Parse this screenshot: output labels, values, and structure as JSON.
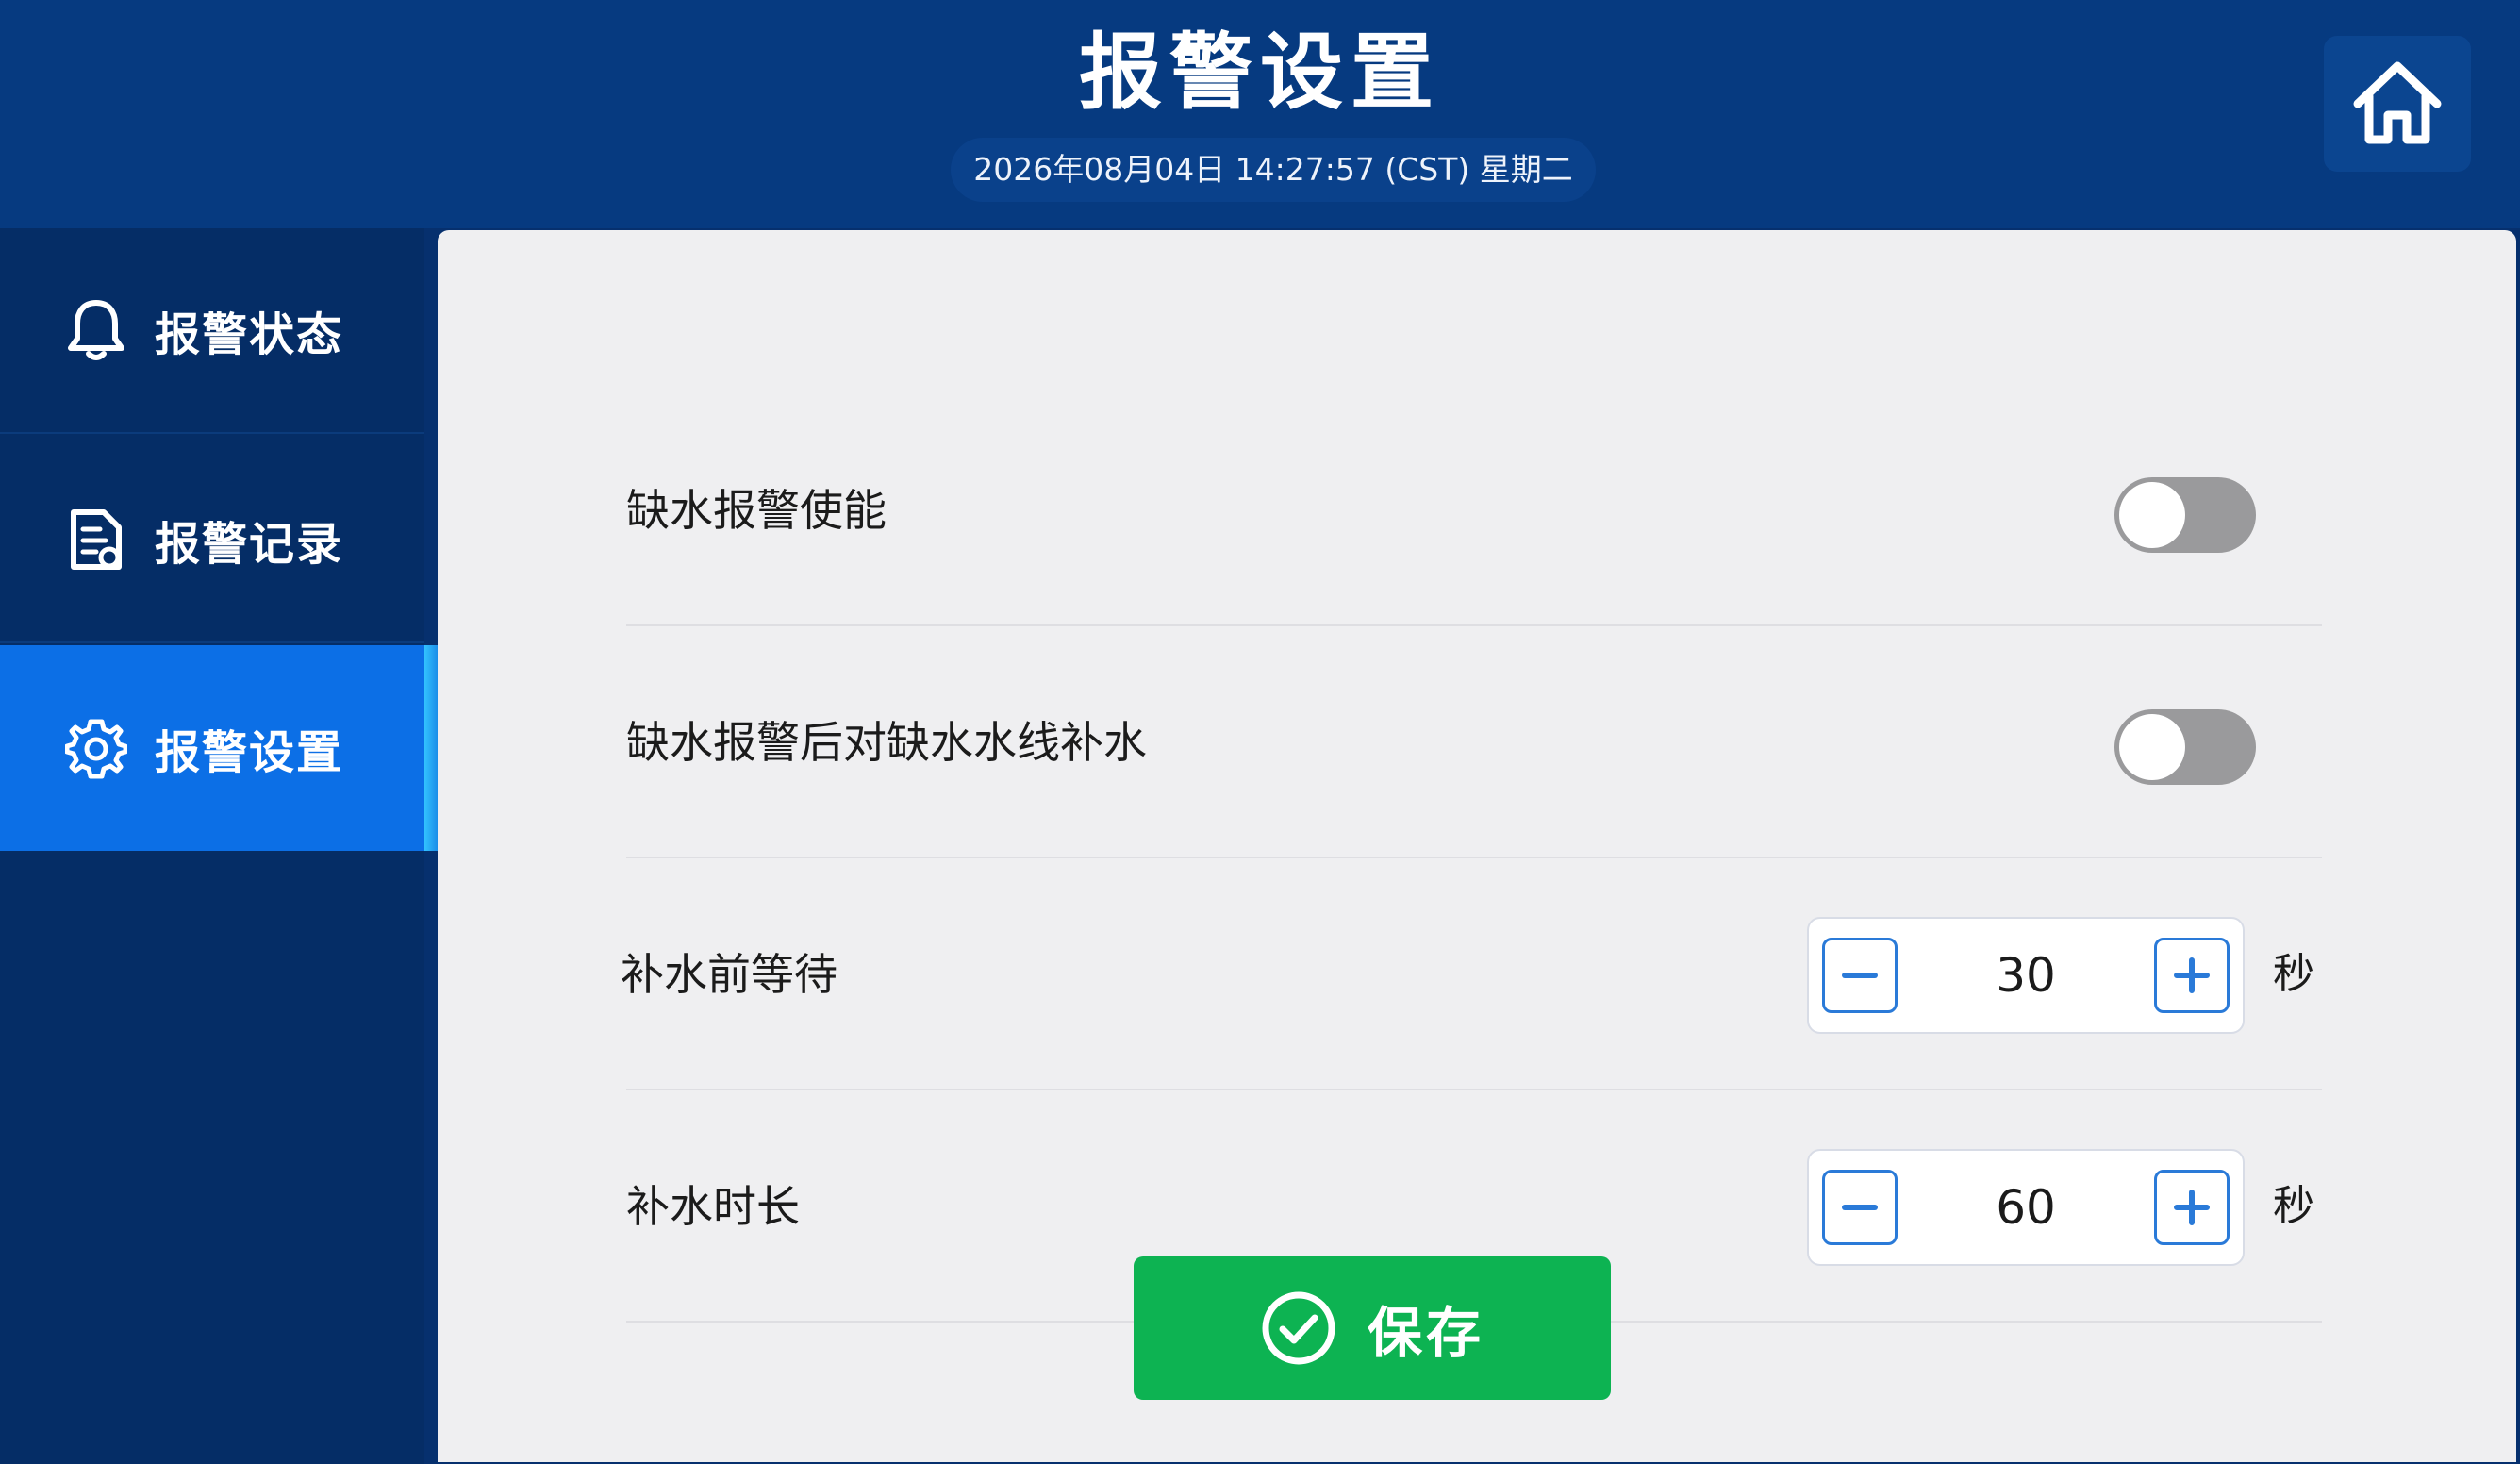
{
  "header": {
    "title": "报警设置",
    "datetime": "2026年08月04日 14:27:57 (CST) 星期二",
    "home_icon": "home-icon"
  },
  "sidebar": {
    "items": [
      {
        "label": "报警状态",
        "icon": "bell-icon",
        "active": false
      },
      {
        "label": "报警记录",
        "icon": "document-icon",
        "active": false
      },
      {
        "label": "报警设置",
        "icon": "gear-icon",
        "active": true
      }
    ]
  },
  "settings": {
    "rows": [
      {
        "label": "缺水报警使能",
        "type": "toggle",
        "on": false
      },
      {
        "label": "缺水报警后对缺水水线补水",
        "type": "toggle",
        "on": false
      },
      {
        "label": "补水前等待",
        "type": "stepper",
        "value": "30",
        "unit": "秒"
      },
      {
        "label": "补水时长",
        "type": "stepper",
        "value": "60",
        "unit": "秒"
      }
    ]
  },
  "save": {
    "label": "保存",
    "icon": "check-circle-icon"
  },
  "colors": {
    "header_bg": "#063a80",
    "sidebar_bg": "#052d66",
    "active_item": "#0c6fe6",
    "panel_bg": "#efeff1",
    "save_green": "#0db352",
    "stepper_blue": "#2a7ad8",
    "toggle_off": "#9a9a9c"
  }
}
